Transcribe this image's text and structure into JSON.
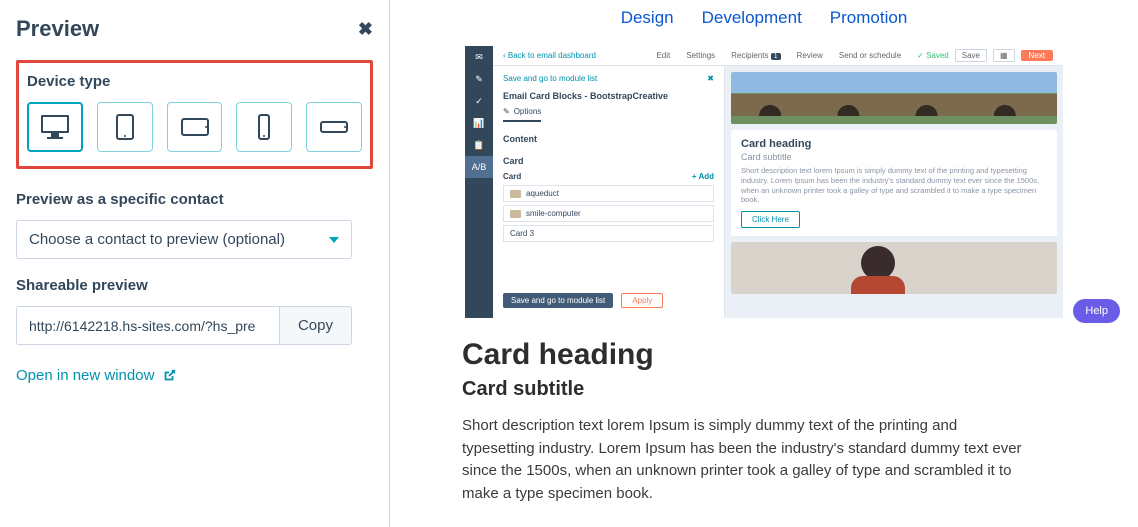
{
  "panel": {
    "title": "Preview",
    "close_label": "✖",
    "device_type_label": "Device type",
    "devices": [
      "desktop",
      "tablet-portrait",
      "tablet-landscape",
      "phone-portrait",
      "phone-landscape"
    ],
    "contact_label": "Preview as a specific contact",
    "contact_placeholder": "Choose a contact to preview (optional)",
    "share_label": "Shareable preview",
    "share_url": "http://6142218.hs-sites.com/?hs_pre",
    "copy_label": "Copy",
    "open_label": "Open in new window"
  },
  "tabs": {
    "design": "Design",
    "development": "Development",
    "promotion": "Promotion"
  },
  "shot": {
    "back": "‹  Back to email dashboard",
    "topTabs": {
      "edit": "Edit",
      "settings": "Settings",
      "recipients": "Recipients",
      "recipients_count": "1",
      "review": "Review",
      "send": "Send or schedule"
    },
    "saved": "✓ Saved",
    "save_btn": "Save",
    "next_btn": "Next",
    "nav": [
      "✉",
      "✎",
      "✓",
      "📊",
      "📋",
      "A/B"
    ],
    "panel": {
      "save_back": "Save and go to module list",
      "module_title": "Email Card Blocks - BootstrapCreative",
      "options": "Options",
      "content": "Content",
      "card": "Card",
      "card_sub": "Card",
      "add": "+ Add",
      "items": [
        "aqueduct",
        "smile-computer",
        "Card 3"
      ],
      "save_go": "Save and go to module list",
      "apply": "Apply"
    },
    "card1": {
      "heading": "Card heading",
      "subtitle": "Card subtitle",
      "desc": "Short description text lorem Ipsum is simply dummy text of the printing and typesetting industry. Lorem Ipsum has been the industry's standard dummy text ever since the 1500s, when an unknown printer took a galley of type and scrambled it to make a type specimen book.",
      "cta": "Click Here"
    }
  },
  "below": {
    "heading": "Card heading",
    "subtitle": "Card subtitle",
    "desc": "Short description text lorem Ipsum is simply dummy text of the printing and typesetting industry. Lorem Ipsum has been the industry's standard dummy text ever since the 1500s, when an unknown printer took a galley of type and scrambled it to make a type specimen book."
  },
  "help": "Help"
}
